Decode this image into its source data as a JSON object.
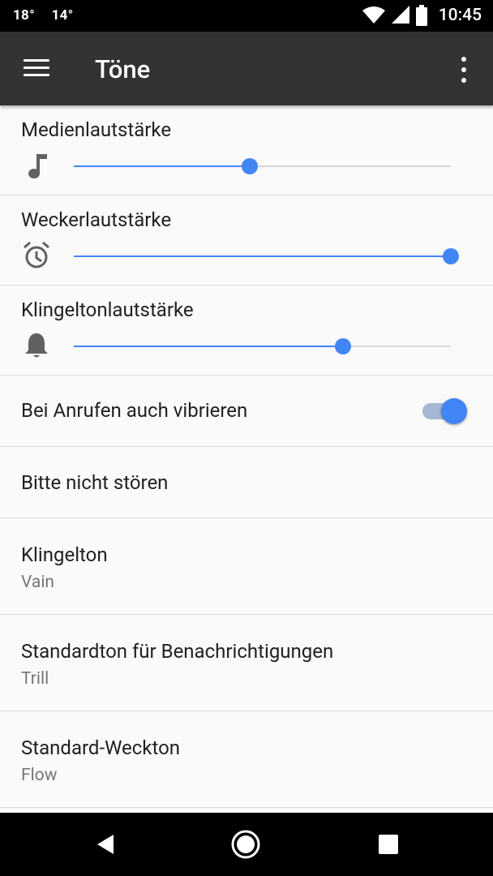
{
  "status_bar": {
    "temp_1": "18°",
    "temp_2": "14°",
    "time": "10:45",
    "icons": [
      "wifi-icon",
      "signal-icon",
      "battery-icon"
    ]
  },
  "app_bar": {
    "title": "Töne",
    "icons": [
      "menu-icon",
      "more-vert-icon"
    ]
  },
  "volumes": [
    {
      "label": "Medienlautstärke",
      "icon": "music-note-icon",
      "level": 0.467
    },
    {
      "label": "Weckerlautstärke",
      "icon": "alarm-clock-icon",
      "level": 1.0
    },
    {
      "label": "Klingeltonlautstärke",
      "icon": "bell-icon",
      "level": 0.714
    }
  ],
  "vibrate": {
    "label": "Bei Anrufen auch vibrieren",
    "enabled": true
  },
  "dnd": {
    "label": "Bitte nicht stören"
  },
  "ringtone": {
    "label": "Klingelton",
    "value": "Vain"
  },
  "notification_sound": {
    "label": "Standardton für Benachrichtigungen",
    "value": "Trill"
  },
  "alarm_sound": {
    "label": "Standard-Weckton",
    "value": "Flow"
  },
  "nav_bar": {
    "icons": [
      "back-icon",
      "home-icon",
      "recents-icon"
    ]
  },
  "colors": {
    "accent": "#4285f4",
    "app_bar": "#333333",
    "status_bar": "#000000"
  }
}
